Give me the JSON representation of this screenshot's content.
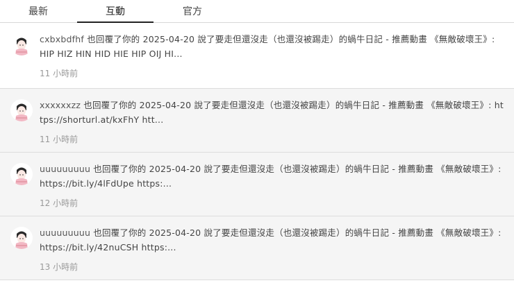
{
  "tabs": [
    {
      "label": "最新"
    },
    {
      "label": "互動"
    },
    {
      "label": "官方"
    }
  ],
  "notifications": [
    {
      "user": "cxbxbdfhf",
      "action": " 也回覆了你的 ",
      "message": "2025-04-20 說了要走但還沒走（也還沒被踢走）的蝸牛日記 - 推薦動畫 《無敵破壞王》: HIP HIZ HIN HID HIE HIP OIJ HI...",
      "time": "11 小時前"
    },
    {
      "user": "xxxxxxzz",
      "action": " 也回覆了你的 ",
      "message": "2025-04-20 說了要走但還沒走（也還沒被踢走）的蝸牛日記 - 推薦動畫 《無敵破壞王》: https://shorturl.at/kxFhY htt...",
      "time": "11 小時前"
    },
    {
      "user": "uuuuuuuuu",
      "action": " 也回覆了你的 ",
      "message": "2025-04-20 說了要走但還沒走（也還沒被踢走）的蝸牛日記 - 推薦動畫 《無敵破壞王》: https://bit.ly/4lFdUpe https:...",
      "time": "12 小時前"
    },
    {
      "user": "uuuuuuuuu",
      "action": " 也回覆了你的 ",
      "message": "2025-04-20 說了要走但還沒走（也還沒被踢走）的蝸牛日記 - 推薦動畫 《無敵破壞王》: https://bit.ly/42nuCSH https:...",
      "time": "13 小時前"
    }
  ]
}
